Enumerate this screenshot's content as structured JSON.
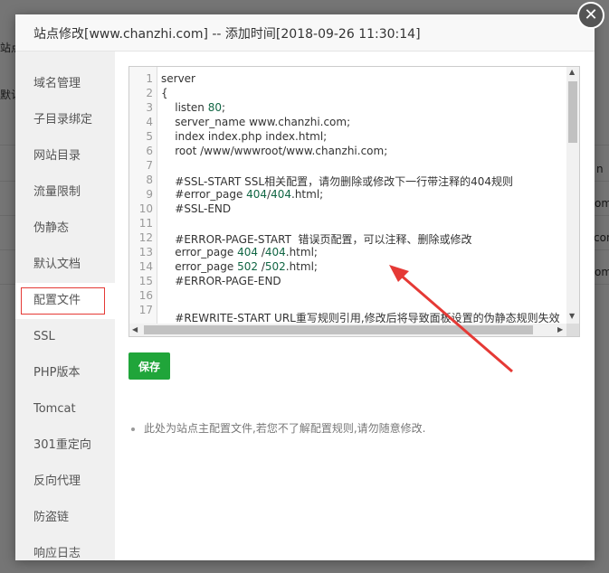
{
  "background": {
    "fragments": [
      "站点",
      "默认",
      "n",
      "om",
      "con",
      "om"
    ]
  },
  "dialog": {
    "title": "站点修改[www.chanzhi.com] -- 添加时间[2018-09-26 11:30:14]",
    "close_icon": "close-icon"
  },
  "sidebar": {
    "items": [
      {
        "label": "域名管理"
      },
      {
        "label": "子目录绑定"
      },
      {
        "label": "网站目录"
      },
      {
        "label": "流量限制"
      },
      {
        "label": "伪静态"
      },
      {
        "label": "默认文档"
      },
      {
        "label": "配置文件"
      },
      {
        "label": "SSL"
      },
      {
        "label": "PHP版本"
      },
      {
        "label": "Tomcat"
      },
      {
        "label": "301重定向"
      },
      {
        "label": "反向代理"
      },
      {
        "label": "防盗链"
      },
      {
        "label": "响应日志"
      }
    ],
    "active_index": 6
  },
  "editor": {
    "line_numbers": [
      "1",
      "2",
      "3",
      "4",
      "5",
      "6",
      "7",
      "8",
      "9",
      "10",
      "11",
      "12",
      "13",
      "14",
      "15",
      "16",
      "17"
    ],
    "lines": [
      "server",
      "{",
      "    listen 80;",
      "    server_name www.chanzhi.com;",
      "    index index.php index.html;",
      "    root /www/wwwroot/www.chanzhi.com;",
      "",
      "    #SSL-START SSL相关配置，请勿删除或修改下一行带注释的404规则",
      "    #error_page 404/404.html;",
      "    #SSL-END",
      "",
      "    #ERROR-PAGE-START  错误页配置，可以注释、删除或修改",
      "    error_page 404 /404.html;",
      "    error_page 502 /502.html;",
      "    #ERROR-PAGE-END",
      "",
      "    #REWRITE-START URL重写规则引用,修改后将导致面板设置的伪静态规则失效"
    ]
  },
  "save_button": {
    "label": "保存"
  },
  "tip": {
    "text": "此处为站点主配置文件,若您不了解配置规则,请勿随意修改."
  },
  "colors": {
    "accent_green": "#20a53a",
    "highlight_red": "#e53935",
    "number_green": "#116644"
  }
}
